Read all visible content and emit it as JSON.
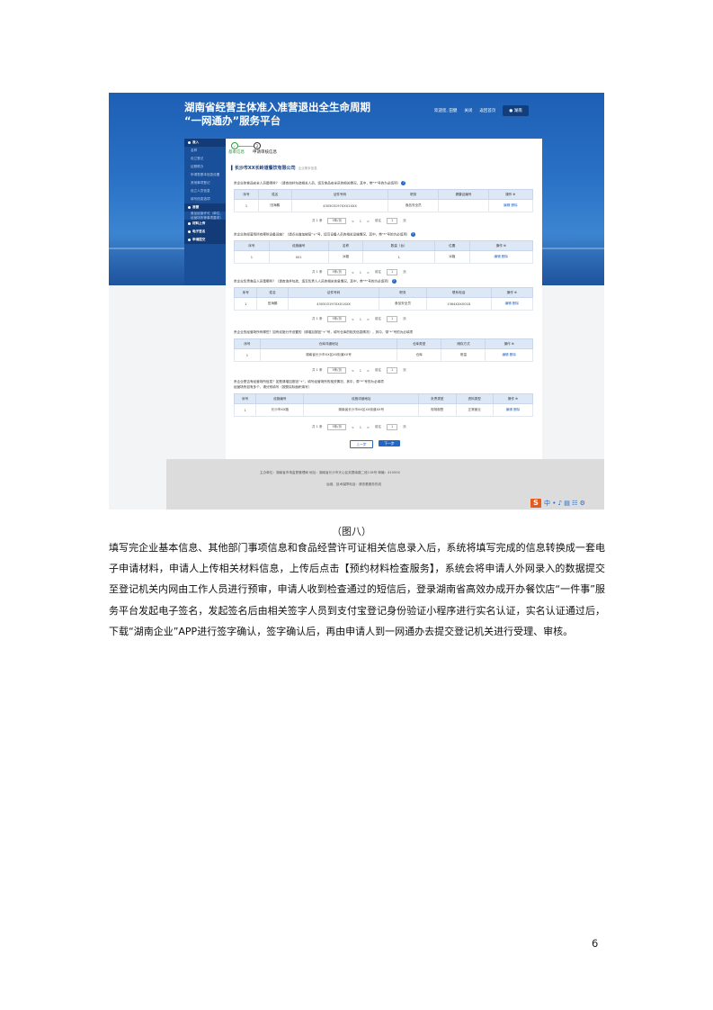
{
  "screenshot": {
    "site_title_line1": "湖南省经营主体准入准营退出全生命周期",
    "site_title_line2": "“一网通办”服务平台",
    "topnav": {
      "welcome": "欢迎您,",
      "user": "田健",
      "close": "关闭",
      "mode": "返回首页",
      "region": "湖南"
    },
    "sidebar": [
      {
        "label": "准入",
        "header": true
      },
      {
        "label": "名称"
      },
      {
        "label": "设立登记"
      },
      {
        "label": "证照联办"
      },
      {
        "label": "申请表基本信息设置"
      },
      {
        "label": "其他事项登记"
      },
      {
        "label": "设立人员信息"
      },
      {
        "label": "填写信息选项"
      },
      {
        "label": "准营",
        "header": true
      },
      {
        "label": "食品经营许可（单位、经营场所等事项要求）"
      },
      {
        "label": "材料上传",
        "header": true
      },
      {
        "label": "电子签名",
        "header": true
      },
      {
        "label": "申请提交",
        "header": true
      }
    ],
    "steps": {
      "step1_num": "✓",
      "step2_num": "2",
      "step1": "基本信息",
      "step2": "申请审核信息"
    },
    "company": {
      "name": "长沙市XX长岭道餐饮有限公司",
      "note": "企业基本信息"
    },
    "q1": "贵企业的食品安全人员是哪些？（请查询并勾选相关人员，填写食品安全员的相关情况，其中，带“*”号的为必填项）",
    "t1": {
      "headers": [
        "序号",
        "姓名",
        "证件号码",
        "职务",
        "健康证编号",
        "操作 ⊕"
      ],
      "rows": [
        [
          "1",
          "田海鹏",
          "430503197XXX1XXX",
          "食品安全员",
          "",
          "编辑  删除"
        ]
      ]
    },
    "p1": {
      "total": "共 1 条",
      "size": "5条/页",
      "prev": "<",
      "page": "1",
      "next": ">",
      "goto": "前往",
      "go_page": "1",
      "unit": "页"
    },
    "q2": "贵企业的经营场所有哪些设备设施？（请点击增加按钮“+”号，填写设备人员的相关设施情况，其中，带“*”号的为必填项）",
    "t2": {
      "headers": [
        "序号",
        "设施编号",
        "名称",
        "数量（台）",
        "位置",
        "操作 ⊕"
      ],
      "rows": [
        [
          "1",
          "001",
          "冰箱",
          "1",
          "冰箱",
          "编辑  删除"
        ]
      ]
    },
    "p2": {
      "total": "共 1 条",
      "size": "5条/页",
      "prev": "<",
      "page": "1",
      "next": ">",
      "goto": "前往",
      "go_page": "1",
      "unit": "页"
    },
    "q3": "贵企业负责食品人员是哪些？（请查询并勾选，填写负责人人员的相关信息情况，其中，带“*”号的为必填项）",
    "t3": {
      "headers": [
        "序号",
        "姓名",
        "证件号码",
        "职务",
        "联系电话",
        "操作 ⊕"
      ],
      "rows": [
        [
          "1",
          "田海鹏",
          "430503197XXX1XXX",
          "食品安全员",
          "1364XXXX018",
          "编辑  删除"
        ]
      ]
    },
    "p3": {
      "total": "共 1 条",
      "size": "5条/页",
      "prev": "<",
      "page": "1",
      "next": ">",
      "goto": "前往",
      "go_page": "1",
      "unit": "页"
    },
    "q4": "贵企业的经营场所有哪些？如有设施分开设置的（请增加按钮“+”号，填写仓库的相关信息情况），其中，带“*”号的为必填项",
    "t4": {
      "headers": [
        "序号",
        "仓库详细地址",
        "仓库类型",
        "储存方式",
        "操作 ⊕"
      ],
      "rows": [
        [
          "1",
          "湖南省长沙市XX区XX街道XX号",
          "仓库",
          "常温",
          "编辑  删除"
        ]
      ]
    },
    "p4": {
      "total": "共 1 条",
      "size": "5条/页",
      "prev": "<",
      "page": "1",
      "next": ">",
      "goto": "前往",
      "go_page": "1",
      "unit": "页"
    },
    "q5a": "贵企业是否有经营场所信息？如是请增加按钮“+”，填写经营场所的相关情况，其中，带“*”号的为必填项",
    "q5b": "经营场所如有多个，请分别填写（按照实际面积填写）",
    "t5": {
      "headers": [
        "序号",
        "设施编号",
        "设施详细地址",
        "负责类型",
        "资料类型",
        "操作 ⊕"
      ],
      "rows": [
        [
          "1",
          "长沙市XX路",
          "湖南省长沙市XX区XX街道XX号",
          "现场制售",
          "正常营业",
          "编辑  删除"
        ]
      ]
    },
    "p5": {
      "total": "共 1 条",
      "size": "5条/页",
      "prev": "<",
      "page": "1",
      "next": ">",
      "goto": "前往",
      "go_page": "1",
      "unit": "页"
    },
    "buttons": {
      "prev": "上一步",
      "next": "下一步"
    },
    "footer": {
      "line1": "主办单位：湖南省市场监督管理局    地址：湖南省长沙市天心区芙蓉南路二段118号    邮编：410004",
      "line2": "运维、技术保障电话：请查看服务热线"
    },
    "ime": {
      "logo": "S",
      "glyphs": "中 • ♪ ▤ ☷ ⚙"
    }
  },
  "caption": "（图八）",
  "paragraph": "填写完企业基本信息、其他部门事项信息和食品经营许可证相关信息录入后，系统将填写完成的信息转换成一套电子申请材料，申请人上传相关材料信息，上传后点击【预约材料检查服务】，系统会将申请人外网录入的数据提交至登记机关内网由工作人员进行预审，申请人收到检查通过的短信后，登录湖南省高效办成开办餐饮店“一件事”服务平台发起电子签名，发起签名后由相关签字人员到支付宝登记身份验证小程序进行实名认证，实名认证通过后，下载“湖南企业”APP进行签字确认，签字确认后，再由申请人到一网通办去提交登记机关进行受理、审核。",
  "page_number": "6"
}
